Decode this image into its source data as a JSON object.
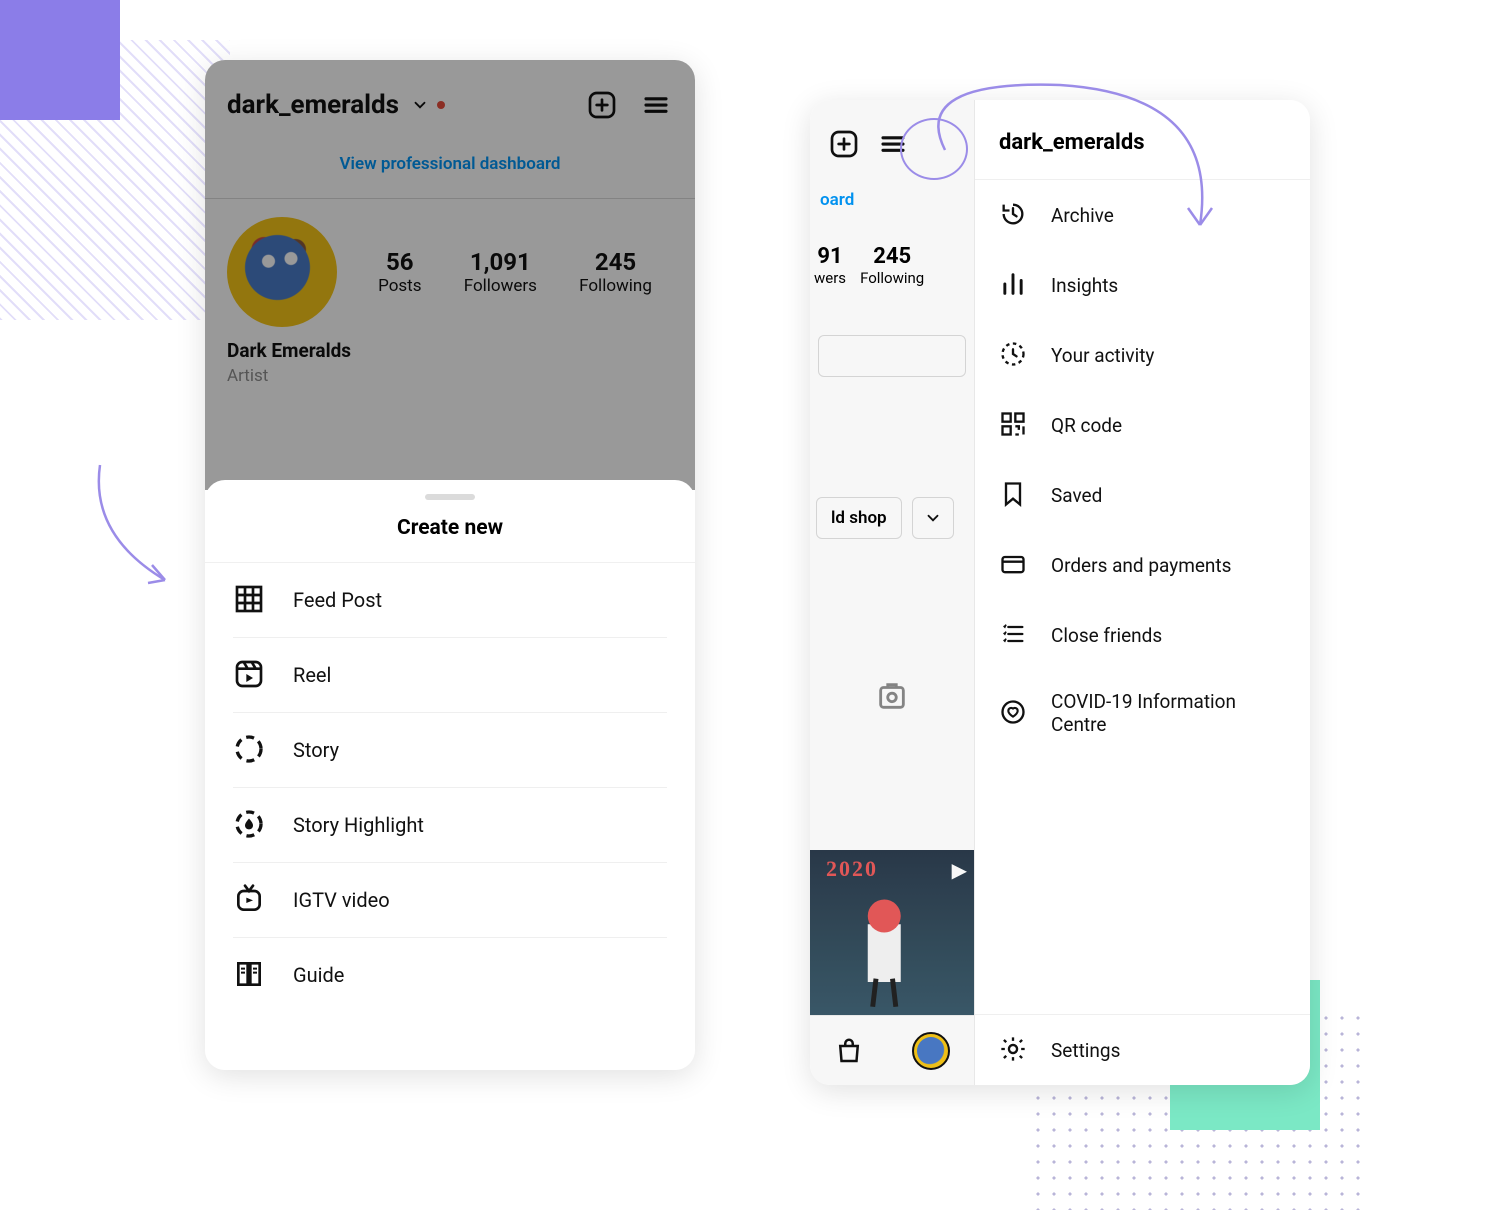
{
  "left_screen": {
    "username": "dark_emeralds",
    "dashboard_link": "View professional dashboard",
    "stats": {
      "posts": {
        "n": "56",
        "l": "Posts"
      },
      "followers": {
        "n": "1,091",
        "l": "Followers"
      },
      "following": {
        "n": "245",
        "l": "Following"
      }
    },
    "display_name": "Dark Emeralds",
    "category": "Artist",
    "sheet_title": "Create new",
    "sheet_items": [
      "Feed Post",
      "Reel",
      "Story",
      "Story Highlight",
      "IGTV video",
      "Guide"
    ]
  },
  "right_screen": {
    "username": "dark_emeralds",
    "partial_oard": "oard",
    "stats": {
      "followers": {
        "n": "91",
        "l": "wers"
      },
      "following": {
        "n": "245",
        "l": "Following"
      }
    },
    "shop_btn": "ld shop",
    "thumb_year": "2020",
    "menu": [
      "Archive",
      "Insights",
      "Your activity",
      "QR code",
      "Saved",
      "Orders and payments",
      "Close friends",
      "COVID-19 Information Centre"
    ],
    "settings": "Settings"
  }
}
